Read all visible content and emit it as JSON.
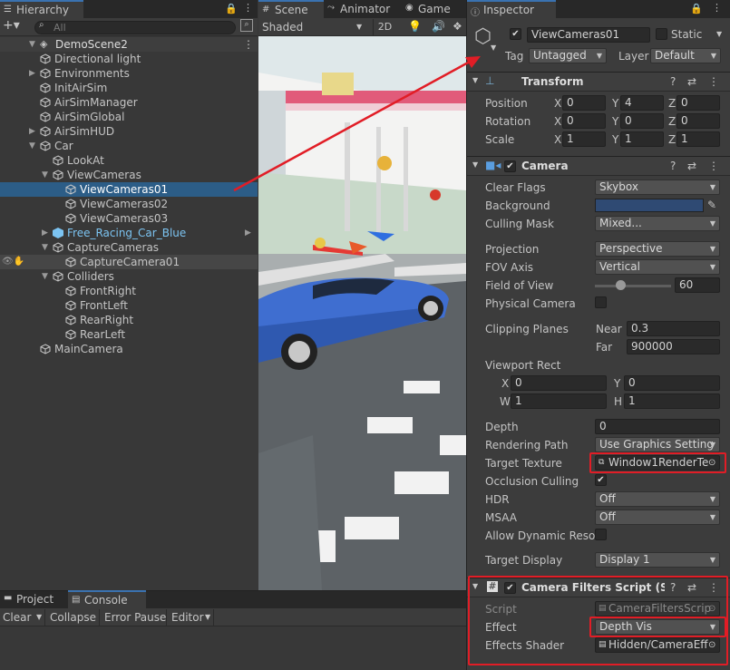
{
  "hierarchy": {
    "tab": "Hierarchy",
    "search_placeholder": "All",
    "scene": "DemoScene2",
    "items": [
      {
        "label": "Directional light"
      },
      {
        "label": "Environments"
      },
      {
        "label": "InitAirSim"
      },
      {
        "label": "AirSimManager"
      },
      {
        "label": "AirSimGlobal"
      },
      {
        "label": "AirSimHUD"
      },
      {
        "label": "Car"
      },
      {
        "label": "LookAt"
      },
      {
        "label": "ViewCameras"
      },
      {
        "label": "ViewCameras01"
      },
      {
        "label": "ViewCameras02"
      },
      {
        "label": "ViewCameras03"
      },
      {
        "label": "Free_Racing_Car_Blue"
      },
      {
        "label": "CaptureCameras"
      },
      {
        "label": "CaptureCamera01"
      },
      {
        "label": "Colliders"
      },
      {
        "label": "FrontRight"
      },
      {
        "label": "FrontLeft"
      },
      {
        "label": "RearRight"
      },
      {
        "label": "RearLeft"
      },
      {
        "label": "MainCamera"
      }
    ]
  },
  "scene": {
    "tabs": [
      "Scene",
      "Animator",
      "Game"
    ],
    "shading": "Shaded",
    "mode_2d": "2D"
  },
  "bottom": {
    "tabs": [
      "Project",
      "Console"
    ],
    "toolbar": [
      "Clear",
      "Collapse",
      "Error Pause",
      "Editor"
    ]
  },
  "inspector": {
    "tab": "Inspector",
    "object_name": "ViewCameras01",
    "static_label": "Static",
    "tag_label": "Tag",
    "tag_value": "Untagged",
    "layer_label": "Layer",
    "layer_value": "Default",
    "transform": {
      "title": "Transform",
      "rows": [
        {
          "label": "Position",
          "x": "0",
          "y": "4",
          "z": "0"
        },
        {
          "label": "Rotation",
          "x": "0",
          "y": "0",
          "z": "0"
        },
        {
          "label": "Scale",
          "x": "1",
          "y": "1",
          "z": "1"
        }
      ]
    },
    "camera": {
      "title": "Camera",
      "clear_flags_label": "Clear Flags",
      "clear_flags": "Skybox",
      "background_label": "Background",
      "background_color": "#2f4a73",
      "culling_mask_label": "Culling Mask",
      "culling_mask": "Mixed...",
      "projection_label": "Projection",
      "projection": "Perspective",
      "fov_axis_label": "FOV Axis",
      "fov_axis": "Vertical",
      "fov_label": "Field of View",
      "fov": "60",
      "fov_fraction": 0.33,
      "physical_label": "Physical Camera",
      "clipping_label": "Clipping Planes",
      "near_label": "Near",
      "near": "0.3",
      "far_label": "Far",
      "far": "900000",
      "viewport_label": "Viewport Rect",
      "vx": "0",
      "vy": "0",
      "vw": "1",
      "vh": "1",
      "depth_label": "Depth",
      "depth": "0",
      "rendering_path_label": "Rendering Path",
      "rendering_path": "Use Graphics Setting",
      "target_texture_label": "Target Texture",
      "target_texture": "Window1RenderTe",
      "occlusion_label": "Occlusion Culling",
      "hdr_label": "HDR",
      "hdr": "Off",
      "msaa_label": "MSAA",
      "msaa": "Off",
      "dyn_res_label": "Allow Dynamic Resol",
      "target_display_label": "Target Display",
      "target_display": "Display 1"
    },
    "filters": {
      "title": "Camera Filters Script (Scrip",
      "script_label": "Script",
      "script": "CameraFiltersScrip",
      "effect_label": "Effect",
      "effect": "Depth Vis",
      "shader_label": "Effects Shader",
      "shader": "Hidden/CameraEff"
    }
  }
}
